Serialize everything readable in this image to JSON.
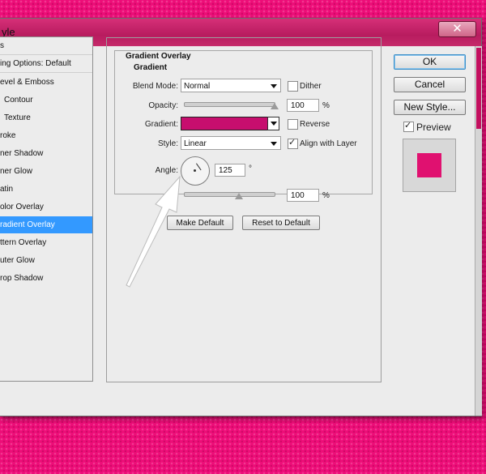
{
  "window": {
    "title": "yle",
    "close_symbol": "✕"
  },
  "styles_list": [
    {
      "label": "s",
      "selected": false
    },
    {
      "label": "ing Options: Default",
      "selected": false
    },
    {
      "label": "evel & Emboss",
      "selected": false
    },
    {
      "label": "Contour",
      "selected": false
    },
    {
      "label": "Texture",
      "selected": false
    },
    {
      "label": "roke",
      "selected": false
    },
    {
      "label": "ner Shadow",
      "selected": false
    },
    {
      "label": "ner Glow",
      "selected": false
    },
    {
      "label": "atin",
      "selected": false
    },
    {
      "label": "olor Overlay",
      "selected": false
    },
    {
      "label": "radient Overlay",
      "selected": true
    },
    {
      "label": "ttern Overlay",
      "selected": false
    },
    {
      "label": "uter Glow",
      "selected": false
    },
    {
      "label": "rop Shadow",
      "selected": false
    }
  ],
  "panel": {
    "section_title": "Gradient Overlay",
    "group_title": "Gradient",
    "blend_mode": {
      "label": "Blend Mode:",
      "value": "Normal"
    },
    "dither": {
      "label": "Dither",
      "checked": false
    },
    "opacity": {
      "label": "Opacity:",
      "value": "100",
      "unit": "%",
      "fraction": 1.0
    },
    "gradient": {
      "label": "Gradient:",
      "color": "#c70e6e"
    },
    "reverse": {
      "label": "Reverse",
      "checked": false
    },
    "style": {
      "label": "Style:",
      "value": "Linear"
    },
    "align_with_layer": {
      "label": "Align with Layer",
      "checked": true
    },
    "angle": {
      "label": "Angle:",
      "value": "125",
      "unit": "°"
    },
    "scale": {
      "label": "S",
      "value": "100",
      "unit": "%",
      "fraction": 0.5
    },
    "make_default": "Make Default",
    "reset_to_default": "Reset to Default"
  },
  "right_buttons": {
    "ok": "OK",
    "cancel": "Cancel",
    "new_style": "New Style...",
    "preview": {
      "label": "Preview",
      "checked": true
    },
    "preview_color": "#e01170"
  },
  "colors": {
    "background": "#ed0d78",
    "selection": "#3399ff",
    "titlebar": "#c42566"
  }
}
